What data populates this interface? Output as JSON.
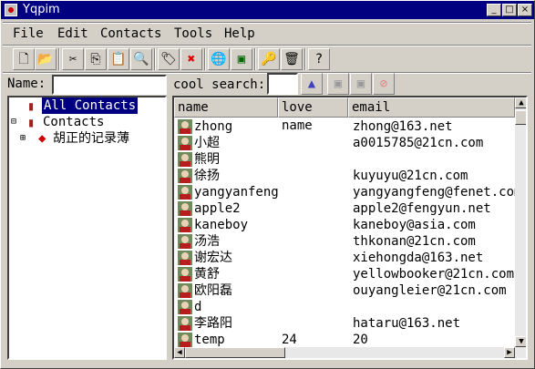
{
  "window": {
    "title": "Yqpim"
  },
  "menu": [
    "File",
    "Edit",
    "Contacts",
    "Tools",
    "Help"
  ],
  "toolbar": [
    {
      "name": "new-icon",
      "glyph": "🗋"
    },
    {
      "name": "open-icon",
      "glyph": "📂"
    },
    {
      "name": "cut-icon",
      "glyph": "✂"
    },
    {
      "name": "copy-icon",
      "glyph": "⎘"
    },
    {
      "name": "paste-icon",
      "glyph": "📋"
    },
    {
      "name": "find-icon",
      "glyph": "🔍"
    },
    {
      "name": "tag-icon",
      "glyph": "🏷"
    },
    {
      "name": "delete-icon",
      "glyph": "✖"
    },
    {
      "name": "world-icon",
      "glyph": "🌐"
    },
    {
      "name": "card-icon",
      "glyph": "▣"
    },
    {
      "name": "key-icon",
      "glyph": "🔑"
    },
    {
      "name": "trash-icon",
      "glyph": "🗑"
    },
    {
      "name": "help-icon",
      "glyph": "?"
    }
  ],
  "name_label": "Name:",
  "cool_search_label": "cool search:",
  "tree": {
    "items": [
      {
        "label": "All Contacts",
        "selected": true
      },
      {
        "label": "Contacts",
        "selected": false
      },
      {
        "label": "胡正的记录薄",
        "selected": false
      }
    ]
  },
  "table": {
    "columns": [
      "name",
      "love name",
      "email"
    ],
    "rows": [
      {
        "name": "zhong",
        "love": "",
        "email": "zhong@163.net"
      },
      {
        "name": "小超",
        "love": "",
        "email": "a0015785@21cn.com"
      },
      {
        "name": "熊明",
        "love": "",
        "email": ""
      },
      {
        "name": "徐扬",
        "love": "",
        "email": "kuyuyu@21cn.com"
      },
      {
        "name": "yangyanfeng",
        "love": "",
        "email": "yangyangfeng@fenet.com"
      },
      {
        "name": "apple2",
        "love": "",
        "email": "apple2@fengyun.net"
      },
      {
        "name": "kaneboy",
        "love": "",
        "email": "kaneboy@asia.com"
      },
      {
        "name": "汤浩",
        "love": "",
        "email": "thkonan@21cn.com"
      },
      {
        "name": "谢宏达",
        "love": "",
        "email": "xiehongda@163.net"
      },
      {
        "name": "黄舒",
        "love": "",
        "email": "yellowbooker@21cn.com"
      },
      {
        "name": "欧阳磊",
        "love": "",
        "email": "ouyangleier@21cn.com"
      },
      {
        "name": "d",
        "love": "",
        "email": ""
      },
      {
        "name": "李路阳",
        "love": "",
        "email": "hataru@163.net"
      },
      {
        "name": "temp",
        "love": "24",
        "email": "20"
      }
    ]
  }
}
